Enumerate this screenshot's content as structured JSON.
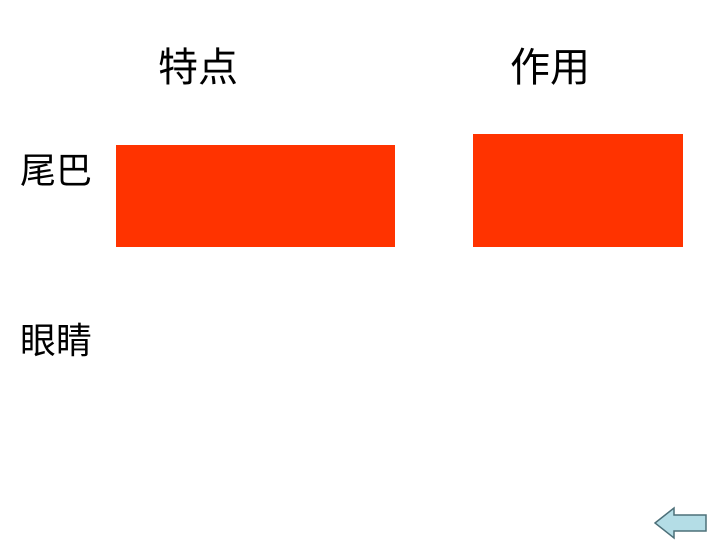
{
  "headers": {
    "feature": "特点",
    "function": "作用"
  },
  "rows": [
    {
      "label": "尾巴"
    },
    {
      "label": "眼睛"
    }
  ],
  "colors": {
    "cover_block": "#ff3300",
    "back_arrow_fill": "#b4dde6",
    "back_arrow_stroke": "#4d7079"
  },
  "icons": {
    "back": "left-arrow-icon"
  }
}
